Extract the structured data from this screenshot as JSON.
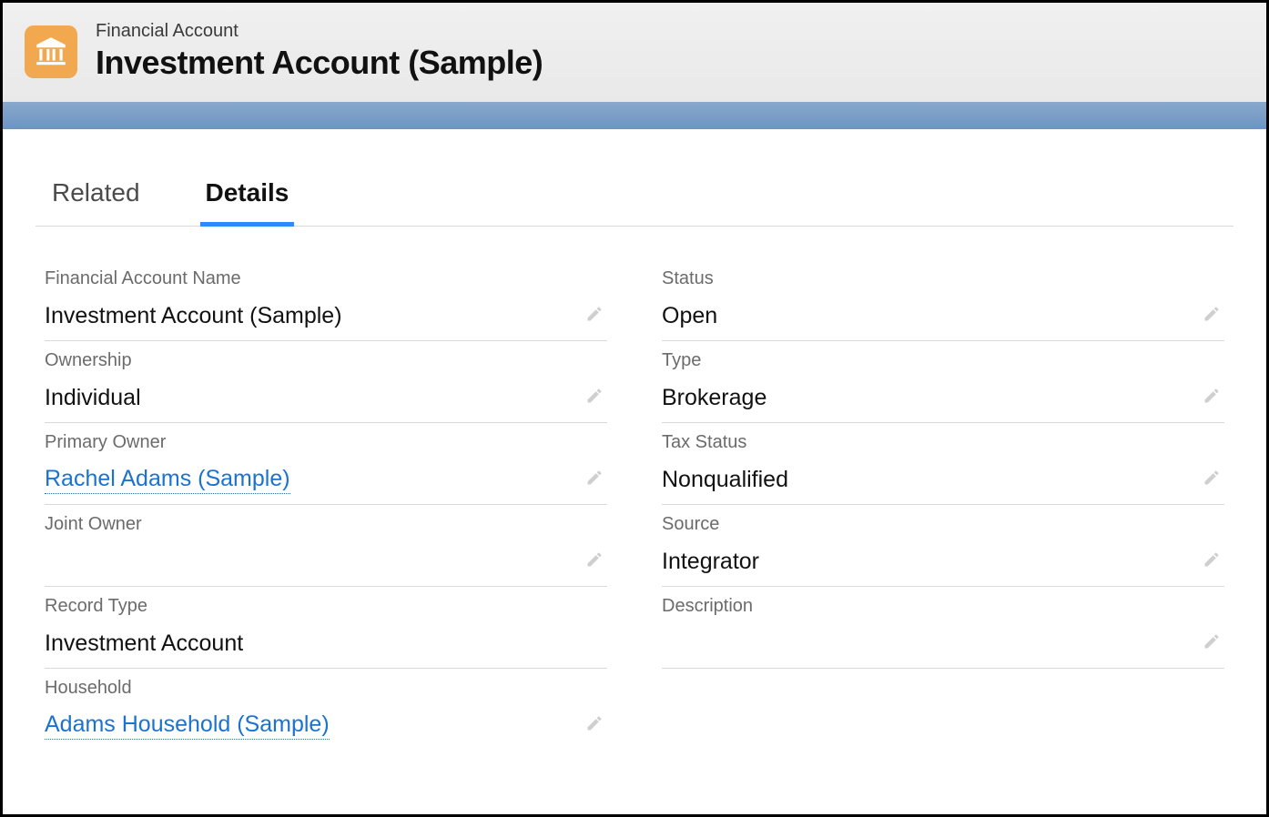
{
  "header": {
    "eyebrow": "Financial Account",
    "title": "Investment Account (Sample)"
  },
  "tabs": {
    "related": "Related",
    "details": "Details"
  },
  "fields": {
    "financialAccountName": {
      "label": "Financial Account Name",
      "value": "Investment Account (Sample)"
    },
    "ownership": {
      "label": "Ownership",
      "value": "Individual"
    },
    "primaryOwner": {
      "label": "Primary Owner",
      "value": "Rachel Adams (Sample)"
    },
    "jointOwner": {
      "label": "Joint Owner",
      "value": ""
    },
    "recordType": {
      "label": "Record Type",
      "value": "Investment Account"
    },
    "household": {
      "label": "Household",
      "value": "Adams Household (Sample)"
    },
    "status": {
      "label": "Status",
      "value": "Open"
    },
    "type": {
      "label": "Type",
      "value": "Brokerage"
    },
    "taxStatus": {
      "label": "Tax Status",
      "value": "Nonqualified"
    },
    "source": {
      "label": "Source",
      "value": "Integrator"
    },
    "description": {
      "label": "Description",
      "value": ""
    }
  }
}
